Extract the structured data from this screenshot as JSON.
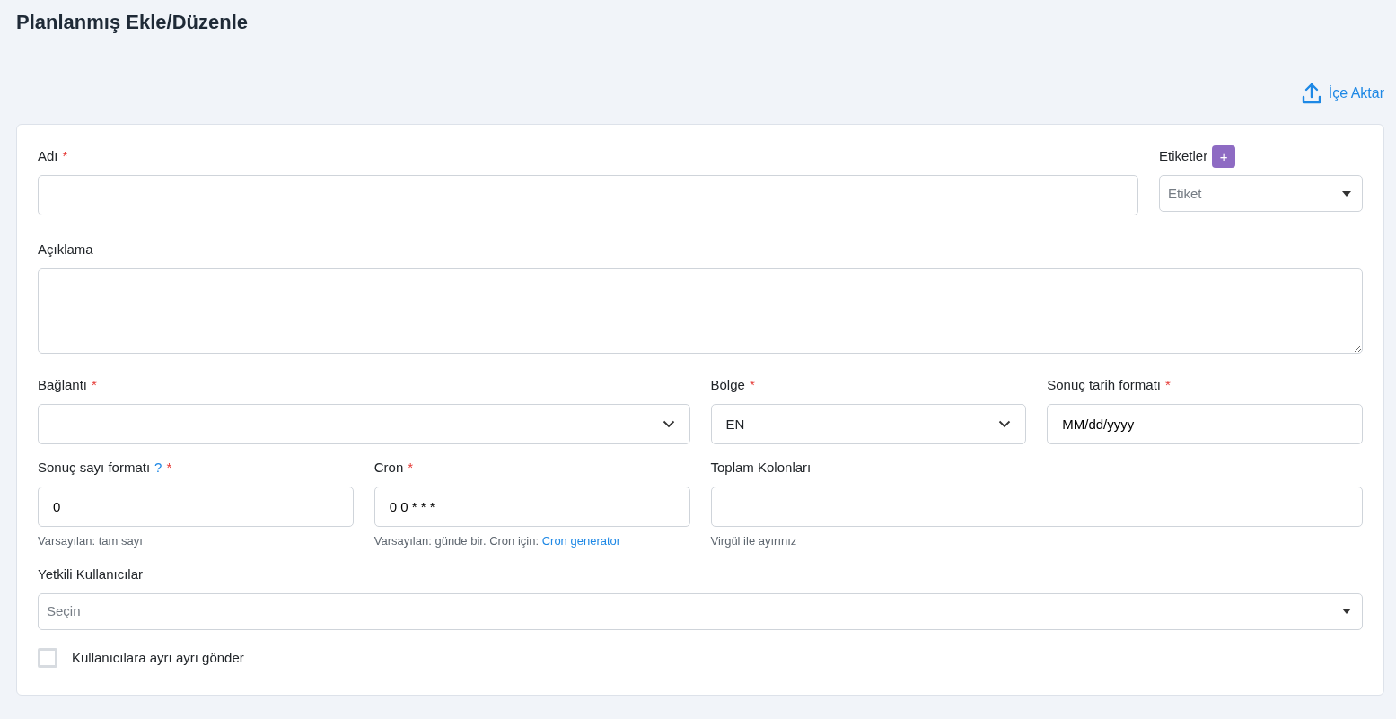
{
  "title": "Planlanmış Ekle/Düzenle",
  "import_link": {
    "label": "İçe Aktar"
  },
  "rows": [
    [
      {
        "kind": "text",
        "label": "Adı",
        "required_mark": "*"
      },
      {
        "kind": "tags",
        "label": "Etiketler",
        "add_button": "+",
        "placeholder": "Etiket"
      }
    ],
    [
      {
        "kind": "textarea",
        "label": "Açıklama"
      }
    ],
    [
      {
        "kind": "select",
        "label": "Bağlantı",
        "required_mark": "*"
      },
      {
        "kind": "select",
        "label": "Bölge",
        "required_mark": "*",
        "value": "EN"
      },
      {
        "kind": "text",
        "label": "Sonuç tarih formatı",
        "required_mark": "*",
        "value": "MM/dd/yyyy"
      }
    ],
    [
      {
        "kind": "text",
        "label": "Sonuç sayı formatı",
        "help": "?",
        "required_mark": "*",
        "value": "0",
        "hint": "Varsayılan: tam sayı"
      },
      {
        "kind": "text",
        "label": "Cron",
        "required_mark": "*",
        "value": "0 0 * * *",
        "hint": "Varsayılan: günde bir. Cron için:",
        "hint_link": "Cron generator"
      },
      {
        "kind": "text",
        "label": "Toplam Kolonları",
        "hint": "Virgül ile ayırınız"
      }
    ],
    [
      {
        "kind": "multiselect",
        "label": "Yetkili Kullanıcılar",
        "placeholder": "Seçin"
      }
    ]
  ],
  "send_separately": {
    "label": "Kullanıcılara ayrı ayrı gönder",
    "checked": false
  }
}
